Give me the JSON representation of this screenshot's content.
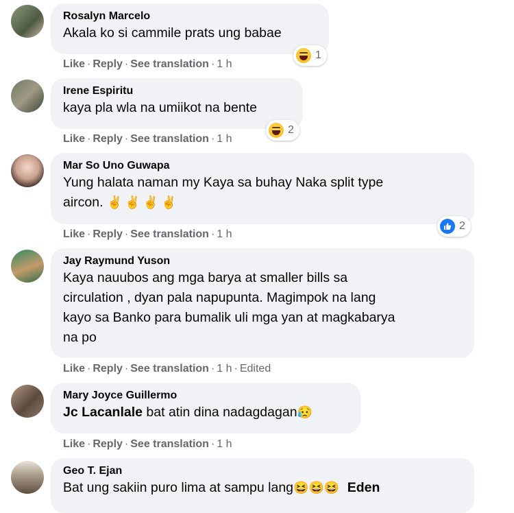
{
  "comments": [
    {
      "author": "Rosalyn Marcelo",
      "text": "Akala ko si cammile prats ung babae",
      "actions": {
        "like": "Like",
        "reply": "Reply",
        "translate": "See translation",
        "time": "1 h"
      },
      "reaction": {
        "icon": "haha-icon",
        "count": "1"
      }
    },
    {
      "author": "Irene Espiritu",
      "text": "kaya pla wla na umiikot na bente",
      "actions": {
        "like": "Like",
        "reply": "Reply",
        "translate": "See translation",
        "time": "1 h"
      },
      "reaction": {
        "icon": "haha-icon",
        "count": "2"
      }
    },
    {
      "author": "Mar So Uno Guwapa",
      "text_line1": "Yung halata naman my Kaya sa buhay Naka split type",
      "text_line2": "aircon.",
      "emojis": "✌✌✌✌",
      "actions": {
        "like": "Like",
        "reply": "Reply",
        "translate": "See translation",
        "time": "1 h"
      },
      "reaction": {
        "icon": "like-icon",
        "count": "2"
      }
    },
    {
      "author": "Jay Raymund Yuson",
      "text_line1": "Kaya nauubos ang mga barya at smaller bills sa",
      "text_line2": "circulation , dyan pala napupunta. Magimpok na lang",
      "text_line3": "kayo sa Banko para bumalik uli mga yan at magkabarya",
      "text_line4": "na po",
      "actions": {
        "like": "Like",
        "reply": "Reply",
        "translate": "See translation",
        "time": "1 h",
        "edited": "Edited"
      }
    },
    {
      "author": "Mary Joyce Guillermo",
      "mention": "Jc Lacanlale",
      "text": " bat atin dina nadagdagan",
      "emoji": "😥",
      "actions": {
        "like": "Like",
        "reply": "Reply",
        "translate": "See translation",
        "time": "1 h"
      }
    },
    {
      "author": "Geo T. Ejan",
      "text": "Bat ung sakiin puro lima at sampu lang",
      "emojis": "😆😆😆",
      "mention": "Eden"
    }
  ],
  "colors": {
    "bubble": "#f0f2f5",
    "meta": "#65676b",
    "like_blue": "#1877f2"
  }
}
